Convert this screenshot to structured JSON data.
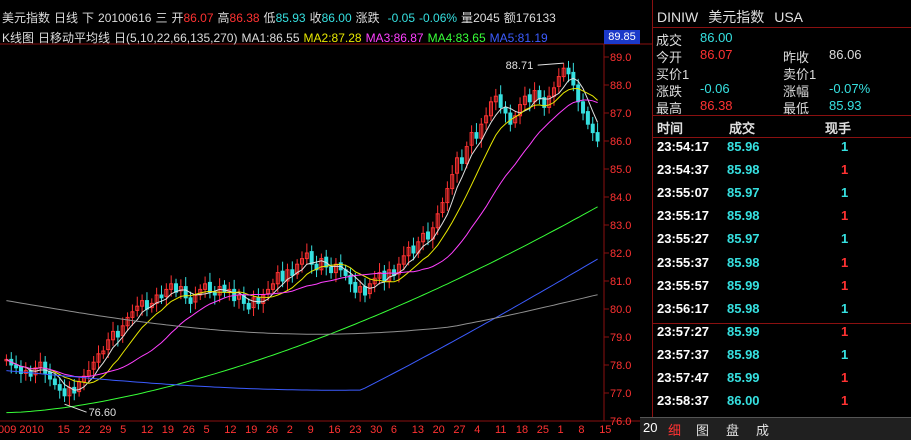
{
  "header": {
    "name": "美元指数",
    "period": "日线",
    "dir": "下",
    "date": "20100616",
    "weekday": "三",
    "open_label": "开",
    "open": "86.07",
    "high_label": "高",
    "high": "86.38",
    "low_label": "低",
    "low": "85.93",
    "close_label": "收",
    "close": "86.00",
    "chg_label": "涨跌",
    "chg": "-0.05",
    "chg_pct": "-0.06%",
    "vol_label": "量",
    "vol": "2045",
    "amt_label": "额",
    "amt": "176133"
  },
  "ma_header": {
    "title": "K线图",
    "mode": "日移动平均线",
    "mode_prefix": "日",
    "params": "(5,10,22,66,135,270)",
    "ma1": "MA1:86.55",
    "ma2": "MA2:87.28",
    "ma3": "MA3:86.87",
    "ma4": "MA4:83.65",
    "ma5": "MA5:81.19"
  },
  "last_price_box": "89.85",
  "colors": {
    "up": "#ff3232",
    "down": "#36e0e0",
    "ma1": "#e0e0e0",
    "ma2": "#e8e800",
    "ma3": "#ff40ff",
    "ma4": "#38ff38",
    "ma5": "#3c5cff",
    "ma6": "#909090",
    "grid": "#8a1010"
  },
  "chart_data": {
    "type": "candlestick",
    "ylim": [
      76.0,
      89.5
    ],
    "yticks": [
      "89.0",
      "88.0",
      "87.0",
      "86.0",
      "85.0",
      "84.0",
      "83.0",
      "82.0",
      "81.0",
      "80.0",
      "79.0",
      "78.0",
      "77.0",
      "76.0"
    ],
    "xticks": [
      "009",
      "2010",
      "15",
      "22",
      "29",
      "5",
      "12",
      "19",
      "26",
      "5",
      "12",
      "19",
      "26",
      "2",
      "9",
      "16",
      "23",
      "30",
      "6",
      "13",
      "20",
      "27",
      "4",
      "11",
      "18",
      "25",
      "1",
      "8",
      "15"
    ],
    "annotations": {
      "high": "88.71",
      "low": "76.60"
    },
    "closes": [
      78.2,
      78.0,
      77.9,
      77.7,
      77.8,
      77.6,
      77.9,
      78.1,
      77.7,
      77.5,
      77.3,
      77.1,
      76.9,
      77.2,
      77.0,
      77.4,
      77.6,
      77.8,
      78.1,
      78.4,
      78.5,
      78.9,
      79.2,
      79.0,
      79.4,
      79.7,
      79.9,
      80.1,
      80.3,
      80.0,
      80.2,
      80.5,
      80.4,
      80.7,
      80.9,
      80.6,
      80.8,
      80.4,
      80.2,
      80.5,
      80.7,
      80.9,
      80.6,
      80.5,
      80.8,
      80.6,
      80.7,
      80.3,
      80.5,
      80.2,
      80.0,
      80.4,
      80.2,
      80.5,
      80.7,
      80.9,
      81.3,
      81.0,
      81.4,
      81.2,
      81.6,
      81.8,
      82.0,
      81.6,
      81.4,
      81.8,
      81.5,
      81.3,
      81.6,
      81.4,
      81.2,
      80.9,
      80.6,
      80.8,
      80.5,
      80.9,
      81.1,
      81.3,
      81.0,
      81.4,
      81.2,
      81.6,
      81.9,
      82.2,
      82.0,
      82.4,
      82.7,
      82.5,
      82.9,
      83.4,
      83.8,
      84.3,
      84.8,
      85.4,
      85.2,
      85.8,
      86.3,
      86.1,
      86.6,
      86.9,
      87.4,
      87.6,
      87.2,
      87.0,
      86.6,
      86.9,
      87.3,
      87.6,
      87.4,
      87.8,
      87.5,
      87.2,
      87.6,
      87.9,
      88.3,
      88.6,
      88.4,
      88.0,
      87.4,
      87.0,
      86.6,
      86.3,
      86.0
    ],
    "ma_last": {
      "ma1": 86.55,
      "ma2": 87.28,
      "ma3": 86.87,
      "ma4": 83.65,
      "ma5": 81.19
    }
  },
  "panel": {
    "code": "DINIW",
    "name": "美元指数",
    "market": "USA",
    "deal_label": "成交",
    "deal": "86.00",
    "open_label": "今开",
    "open": "86.07",
    "prev_label": "昨收",
    "prev": "86.06",
    "buy_label": "买价1",
    "buy": "",
    "sell_label": "卖价1",
    "sell": "",
    "chg_label": "涨跌",
    "chg": "-0.06",
    "amp_label": "涨幅",
    "amp": "-0.07%",
    "high_label": "最高",
    "high": "86.38",
    "low_label": "最低",
    "low": "85.93"
  },
  "ticks_header": {
    "time": "时间",
    "price": "成交",
    "vol": "现手"
  },
  "ticks": [
    {
      "time": "23:54:17",
      "price": "85.96",
      "vol": "1",
      "dir": "down"
    },
    {
      "time": "23:54:37",
      "price": "85.98",
      "vol": "1",
      "dir": "up"
    },
    {
      "time": "23:55:07",
      "price": "85.97",
      "vol": "1",
      "dir": "down"
    },
    {
      "time": "23:55:17",
      "price": "85.98",
      "vol": "1",
      "dir": "up"
    },
    {
      "time": "23:55:27",
      "price": "85.97",
      "vol": "1",
      "dir": "down"
    },
    {
      "time": "23:55:37",
      "price": "85.98",
      "vol": "1",
      "dir": "up"
    },
    {
      "time": "23:55:57",
      "price": "85.99",
      "vol": "1",
      "dir": "up"
    },
    {
      "time": "23:56:17",
      "price": "85.98",
      "vol": "1",
      "dir": "down"
    },
    {
      "time": "23:57:27",
      "price": "85.99",
      "vol": "1",
      "dir": "up"
    },
    {
      "time": "23:57:37",
      "price": "85.98",
      "vol": "1",
      "dir": "down"
    },
    {
      "time": "23:57:47",
      "price": "85.99",
      "vol": "1",
      "dir": "up"
    },
    {
      "time": "23:58:37",
      "price": "86.00",
      "vol": "1",
      "dir": "up"
    }
  ],
  "tabs": {
    "corner": "20",
    "t1": "细",
    "t2": "图",
    "t3": "盘",
    "t4": "成"
  }
}
